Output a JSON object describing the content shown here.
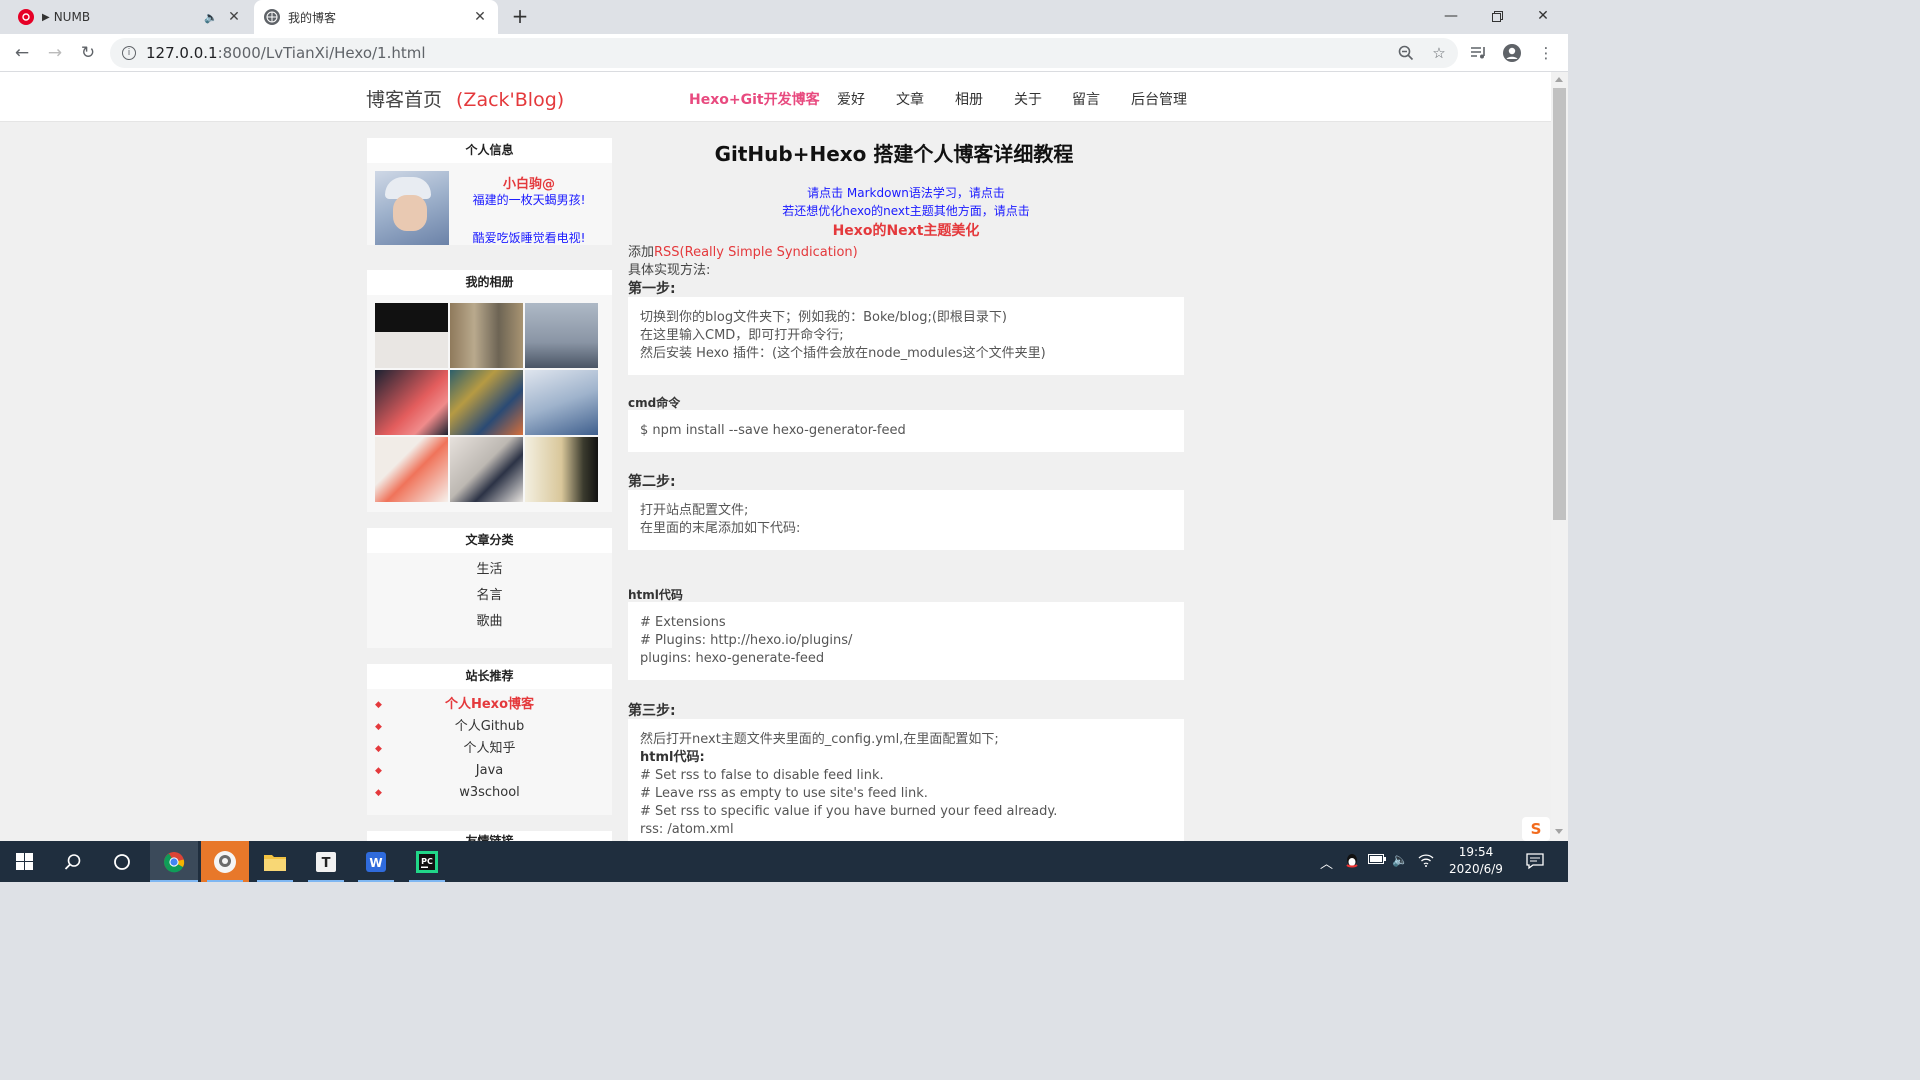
{
  "browser": {
    "tabs": [
      {
        "title": "NUMB",
        "favicon": "netease-music-icon",
        "audio": true
      },
      {
        "title": "我的博客",
        "favicon": "globe-icon"
      }
    ],
    "url_host": "127.0.0.1",
    "url_path": ":8000/LvTianXi/Hexo/1.html"
  },
  "site": {
    "brand": "博客首页",
    "brand_sub": "(Zack'Blog)",
    "nav": [
      "Hexo+Git开发博客",
      "爱好",
      "文章",
      "相册",
      "关于",
      "留言",
      "后台管理"
    ]
  },
  "sidebar": {
    "profile_title": "个人信息",
    "nickname": "小白驹@",
    "tagline": "福建的一枚天蝎男孩!",
    "hobby": "酷爱吃饭睡觉看电视!",
    "album_title": "我的相册",
    "category_title": "文章分类",
    "categories": [
      "生活",
      "名言",
      "歌曲"
    ],
    "recommend_title": "站长推荐",
    "recommends": [
      "个人Hexo博客",
      "个人Github",
      "个人知乎",
      "Java",
      "w3school"
    ],
    "next_block_title": "友情链接"
  },
  "article": {
    "title": "GitHub+Hexo 搭建个人博客详细教程",
    "link1": "请点击 Markdown语法学习，请点击",
    "link2": "若还想优化hexo的next主题其他方面，请点击",
    "link3": "Hexo的Next主题美化",
    "add_prefix": "添加",
    "add_red": "RSS(Really Simple Syndication)",
    "method": "具体实现方法:",
    "step1": "第一步:",
    "step1_lines": [
      "切换到你的blog文件夹下；例如我的：Boke/blog;(即根目录下)",
      "在这里输入CMD，即可打开命令行;",
      "然后安装 Hexo 插件：(这个插件会放在node_modules这个文件夹里)"
    ],
    "cmd_label": "cmd命令",
    "cmd": "$ npm install --save hexo-generator-feed",
    "step2": "第二步:",
    "step2_lines": [
      "打开站点配置文件;",
      "在里面的末尾添加如下代码:"
    ],
    "html_label": "html代码",
    "html_lines": [
      "# Extensions",
      "# Plugins: http://hexo.io/plugins/",
      "plugins: hexo-generate-feed"
    ],
    "step3": "第三步:",
    "step3_intro": "然后打开next主题文件夹里面的_config.yml,在里面配置如下;",
    "step3_label": "html代码:",
    "step3_lines": [
      "# Set rss to false to disable feed link.",
      "# Leave rss as empty to use site's feed link.",
      "# Set rss to specific value if you have burned your feed already.",
      "rss: /atom.xml"
    ]
  },
  "taskbar": {
    "time": "19:54",
    "date": "2020/6/9"
  }
}
